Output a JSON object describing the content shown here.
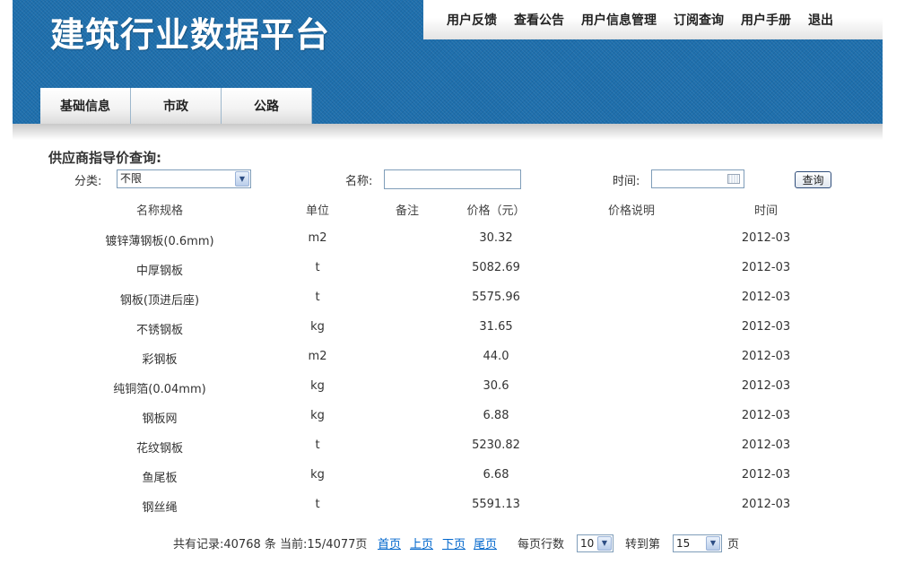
{
  "header": {
    "logo": "建筑行业数据平台",
    "nav": [
      "用户反馈",
      "查看公告",
      "用户信息管理",
      "订阅查询",
      "用户手册",
      "退出"
    ],
    "tabs": [
      "基础信息",
      "市政",
      "公路"
    ]
  },
  "search": {
    "title": "供应商指导价查询:",
    "category_label": "分类:",
    "category_value": "不限",
    "name_label": "名称:",
    "name_value": "",
    "time_label": "时间:",
    "time_value": "",
    "query_button": "查询"
  },
  "table": {
    "headers": [
      "名称规格",
      "单位",
      "备注",
      "价格（元）",
      "价格说明",
      "时间"
    ],
    "rows": [
      {
        "name": "镀锌薄钢板(0.6mm)",
        "unit": "m2",
        "note": "",
        "price": "30.32",
        "desc": "",
        "time": "2012-03"
      },
      {
        "name": "中厚钢板",
        "unit": "t",
        "note": "",
        "price": "5082.69",
        "desc": "",
        "time": "2012-03"
      },
      {
        "name": "钢板(顶进后座)",
        "unit": "t",
        "note": "",
        "price": "5575.96",
        "desc": "",
        "time": "2012-03"
      },
      {
        "name": "不锈钢板",
        "unit": "kg",
        "note": "",
        "price": "31.65",
        "desc": "",
        "time": "2012-03"
      },
      {
        "name": "彩钢板",
        "unit": "m2",
        "note": "",
        "price": "44.0",
        "desc": "",
        "time": "2012-03"
      },
      {
        "name": "纯铜箔(0.04mm)",
        "unit": "kg",
        "note": "",
        "price": "30.6",
        "desc": "",
        "time": "2012-03"
      },
      {
        "name": "钢板网",
        "unit": "kg",
        "note": "",
        "price": "6.88",
        "desc": "",
        "time": "2012-03"
      },
      {
        "name": "花纹钢板",
        "unit": "t",
        "note": "",
        "price": "5230.82",
        "desc": "",
        "time": "2012-03"
      },
      {
        "name": "鱼尾板",
        "unit": "kg",
        "note": "",
        "price": "6.68",
        "desc": "",
        "time": "2012-03"
      },
      {
        "name": "钢丝绳",
        "unit": "t",
        "note": "",
        "price": "5591.13",
        "desc": "",
        "time": "2012-03"
      }
    ]
  },
  "pagination": {
    "summary": "共有记录:40768 条  当前:15/4077页",
    "first": "首页",
    "prev": "上页",
    "next": "下页",
    "last": "尾页",
    "rows_per_page_label": "每页行数",
    "rows_per_page": "10",
    "goto_label": "转到第",
    "goto_page": "15",
    "page_suffix": "页"
  },
  "colors": {
    "header_blue": "#1e6fad",
    "link": "#0066cc"
  }
}
